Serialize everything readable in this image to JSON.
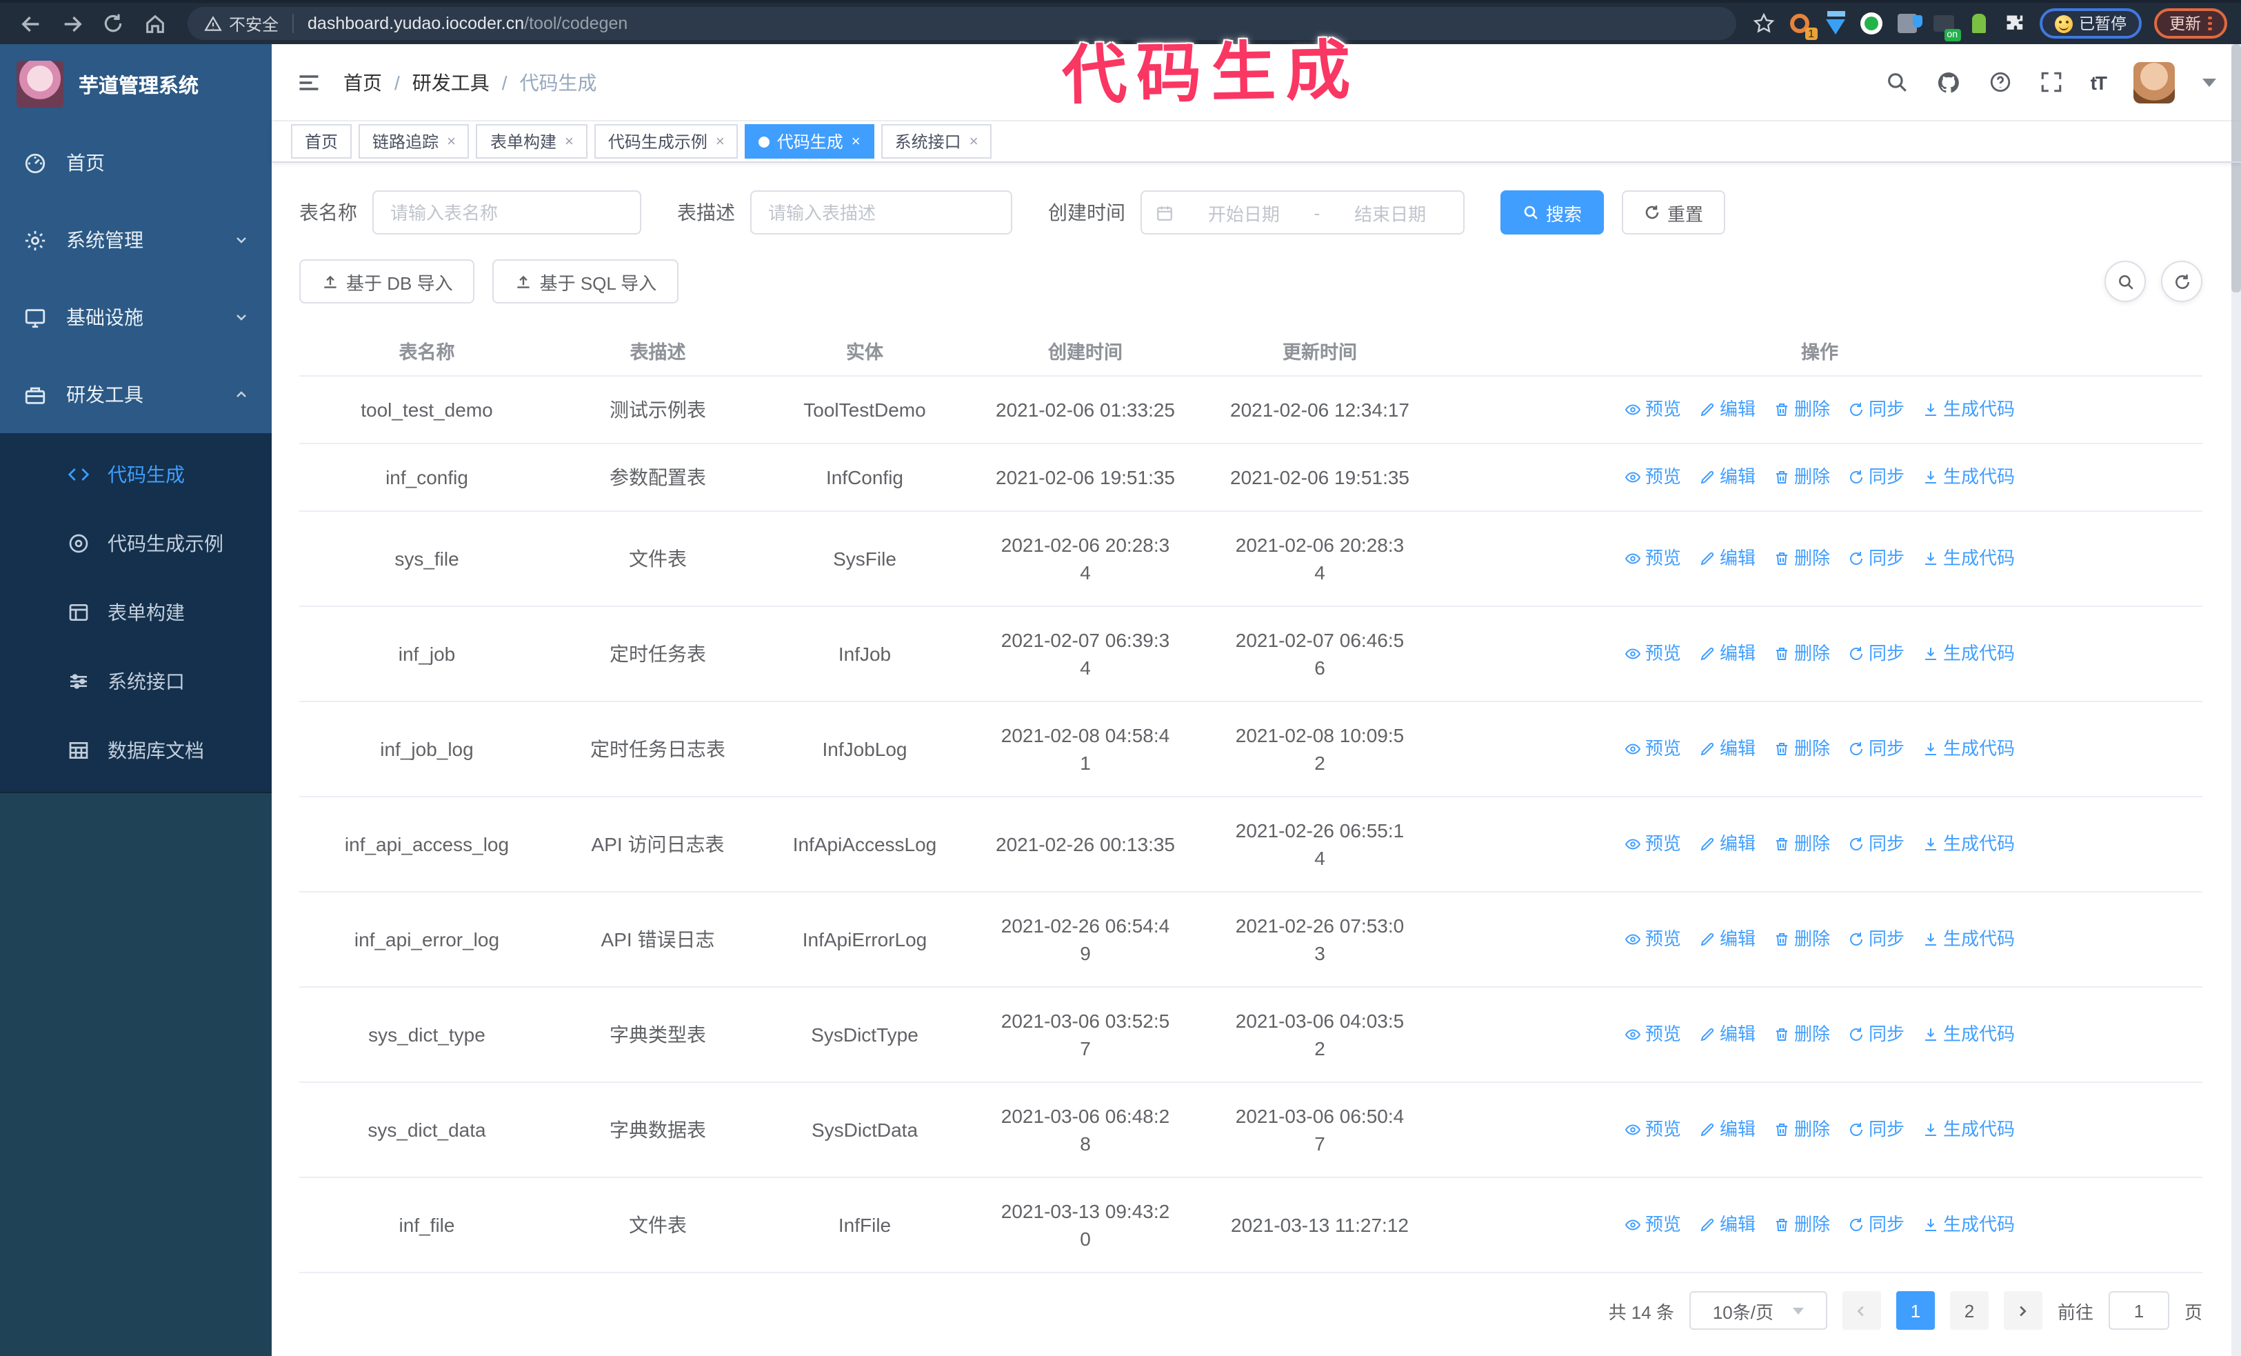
{
  "browser": {
    "security_label": "不安全",
    "url_host": "dashboard.yudao.iocoder.cn",
    "url_path": "/tool/codegen",
    "paused_badge": "已暂停",
    "update_button": "更新"
  },
  "annotation": {
    "title": "代码生成"
  },
  "sidebar": {
    "logo_title": "芋道管理系统",
    "items": [
      {
        "label": "首页"
      },
      {
        "label": "系统管理"
      },
      {
        "label": "基础设施"
      },
      {
        "label": "研发工具"
      }
    ],
    "submenu": [
      {
        "label": "代码生成"
      },
      {
        "label": "代码生成示例"
      },
      {
        "label": "表单构建"
      },
      {
        "label": "系统接口"
      },
      {
        "label": "数据库文档"
      }
    ]
  },
  "navbar": {
    "breadcrumb": [
      "首页",
      "研发工具",
      "代码生成"
    ],
    "separator": "/",
    "font_icon": "tT",
    "help_glyph": "?"
  },
  "tabs": {
    "close_glyph": "×",
    "items": [
      {
        "label": "首页"
      },
      {
        "label": "链路追踪"
      },
      {
        "label": "表单构建"
      },
      {
        "label": "代码生成示例"
      },
      {
        "label": "代码生成"
      },
      {
        "label": "系统接口"
      }
    ]
  },
  "filters": {
    "name_label": "表名称",
    "name_placeholder": "请输入表名称",
    "desc_label": "表描述",
    "desc_placeholder": "请输入表描述",
    "time_label": "创建时间",
    "start_placeholder": "开始日期",
    "range_separator": "-",
    "end_placeholder": "结束日期",
    "search_label": "搜索",
    "reset_label": "重置"
  },
  "toolbar": {
    "import_db_label": "基于 DB 导入",
    "import_sql_label": "基于 SQL 导入"
  },
  "table": {
    "headers": [
      "表名称",
      "表描述",
      "实体",
      "创建时间",
      "更新时间",
      "操作"
    ],
    "actions": [
      "预览",
      "编辑",
      "删除",
      "同步",
      "生成代码"
    ],
    "rows": [
      {
        "name": "tool_test_demo",
        "desc": "测试示例表",
        "entity": "ToolTestDemo",
        "created": "2021-02-06 01:33:25",
        "updated": "2021-02-06 12:34:17"
      },
      {
        "name": "inf_config",
        "desc": "参数配置表",
        "entity": "InfConfig",
        "created": "2021-02-06 19:51:35",
        "updated": "2021-02-06 19:51:35"
      },
      {
        "name": "sys_file",
        "desc": "文件表",
        "entity": "SysFile",
        "created": "2021-02-06 20:28:3\n4",
        "updated": "2021-02-06 20:28:3\n4"
      },
      {
        "name": "inf_job",
        "desc": "定时任务表",
        "entity": "InfJob",
        "created": "2021-02-07 06:39:3\n4",
        "updated": "2021-02-07 06:46:5\n6"
      },
      {
        "name": "inf_job_log",
        "desc": "定时任务日志表",
        "entity": "InfJobLog",
        "created": "2021-02-08 04:58:4\n1",
        "updated": "2021-02-08 10:09:5\n2"
      },
      {
        "name": "inf_api_access_log",
        "desc": "API 访问日志表",
        "entity": "InfApiAccessLog",
        "created": "2021-02-26 00:13:35",
        "updated": "2021-02-26 06:55:1\n4"
      },
      {
        "name": "inf_api_error_log",
        "desc": "API 错误日志",
        "entity": "InfApiErrorLog",
        "created": "2021-02-26 06:54:4\n9",
        "updated": "2021-02-26 07:53:0\n3"
      },
      {
        "name": "sys_dict_type",
        "desc": "字典类型表",
        "entity": "SysDictType",
        "created": "2021-03-06 03:52:5\n7",
        "updated": "2021-03-06 04:03:5\n2"
      },
      {
        "name": "sys_dict_data",
        "desc": "字典数据表",
        "entity": "SysDictData",
        "created": "2021-03-06 06:48:2\n8",
        "updated": "2021-03-06 06:50:4\n7"
      },
      {
        "name": "inf_file",
        "desc": "文件表",
        "entity": "InfFile",
        "created": "2021-03-13 09:43:2\n0",
        "updated": "2021-03-13 11:27:12"
      }
    ]
  },
  "pagination": {
    "total": "共 14 条",
    "page_size": "10条/页",
    "page1": "1",
    "page2": "2",
    "goto_label": "前往",
    "goto_value": "1",
    "goto_suffix": "页"
  }
}
